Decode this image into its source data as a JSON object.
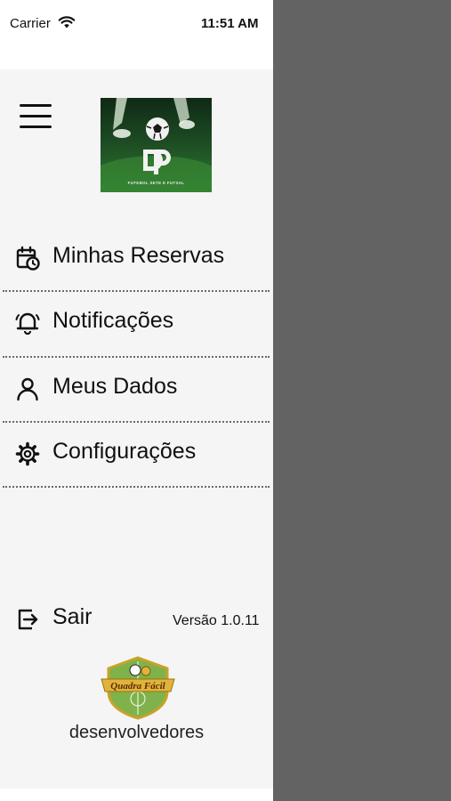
{
  "status_bar": {
    "carrier": "Carrier",
    "time": "11:51 AM"
  },
  "logo": {
    "caption": "FUTEBOL SETE E FUTSAL"
  },
  "menu": {
    "items": [
      {
        "label": "Minhas Reservas",
        "icon": "calendar-clock-icon"
      },
      {
        "label": "Notificações",
        "icon": "bell-icon"
      },
      {
        "label": "Meus Dados",
        "icon": "user-icon"
      },
      {
        "label": "Configurações",
        "icon": "gear-icon"
      }
    ],
    "logout_label": "Sair",
    "logout_icon": "logout-icon"
  },
  "footer": {
    "version": "Versão 1.0.11",
    "badge_text": "Quadra Fácil",
    "developer_text": "desenvolvedores"
  },
  "colors": {
    "drawer_bg": "#f5f5f5",
    "overlay": "#636363",
    "badge_gold": "#e0b43a",
    "badge_green": "#7fb24a"
  }
}
